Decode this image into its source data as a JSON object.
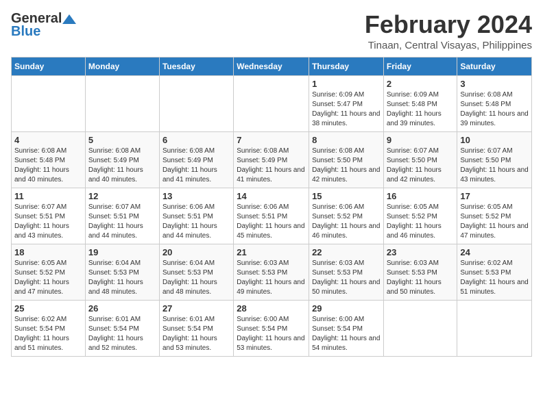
{
  "logo": {
    "general": "General",
    "blue": "Blue"
  },
  "title": "February 2024",
  "subtitle": "Tinaan, Central Visayas, Philippines",
  "days_header": [
    "Sunday",
    "Monday",
    "Tuesday",
    "Wednesday",
    "Thursday",
    "Friday",
    "Saturday"
  ],
  "weeks": [
    [
      {
        "day": "",
        "sunrise": "",
        "sunset": "",
        "daylight": ""
      },
      {
        "day": "",
        "sunrise": "",
        "sunset": "",
        "daylight": ""
      },
      {
        "day": "",
        "sunrise": "",
        "sunset": "",
        "daylight": ""
      },
      {
        "day": "",
        "sunrise": "",
        "sunset": "",
        "daylight": ""
      },
      {
        "day": "1",
        "sunrise": "6:09 AM",
        "sunset": "5:47 PM",
        "daylight": "11 hours and 38 minutes."
      },
      {
        "day": "2",
        "sunrise": "6:09 AM",
        "sunset": "5:48 PM",
        "daylight": "11 hours and 39 minutes."
      },
      {
        "day": "3",
        "sunrise": "6:08 AM",
        "sunset": "5:48 PM",
        "daylight": "11 hours and 39 minutes."
      }
    ],
    [
      {
        "day": "4",
        "sunrise": "6:08 AM",
        "sunset": "5:48 PM",
        "daylight": "11 hours and 40 minutes."
      },
      {
        "day": "5",
        "sunrise": "6:08 AM",
        "sunset": "5:49 PM",
        "daylight": "11 hours and 40 minutes."
      },
      {
        "day": "6",
        "sunrise": "6:08 AM",
        "sunset": "5:49 PM",
        "daylight": "11 hours and 41 minutes."
      },
      {
        "day": "7",
        "sunrise": "6:08 AM",
        "sunset": "5:49 PM",
        "daylight": "11 hours and 41 minutes."
      },
      {
        "day": "8",
        "sunrise": "6:08 AM",
        "sunset": "5:50 PM",
        "daylight": "11 hours and 42 minutes."
      },
      {
        "day": "9",
        "sunrise": "6:07 AM",
        "sunset": "5:50 PM",
        "daylight": "11 hours and 42 minutes."
      },
      {
        "day": "10",
        "sunrise": "6:07 AM",
        "sunset": "5:50 PM",
        "daylight": "11 hours and 43 minutes."
      }
    ],
    [
      {
        "day": "11",
        "sunrise": "6:07 AM",
        "sunset": "5:51 PM",
        "daylight": "11 hours and 43 minutes."
      },
      {
        "day": "12",
        "sunrise": "6:07 AM",
        "sunset": "5:51 PM",
        "daylight": "11 hours and 44 minutes."
      },
      {
        "day": "13",
        "sunrise": "6:06 AM",
        "sunset": "5:51 PM",
        "daylight": "11 hours and 44 minutes."
      },
      {
        "day": "14",
        "sunrise": "6:06 AM",
        "sunset": "5:51 PM",
        "daylight": "11 hours and 45 minutes."
      },
      {
        "day": "15",
        "sunrise": "6:06 AM",
        "sunset": "5:52 PM",
        "daylight": "11 hours and 46 minutes."
      },
      {
        "day": "16",
        "sunrise": "6:05 AM",
        "sunset": "5:52 PM",
        "daylight": "11 hours and 46 minutes."
      },
      {
        "day": "17",
        "sunrise": "6:05 AM",
        "sunset": "5:52 PM",
        "daylight": "11 hours and 47 minutes."
      }
    ],
    [
      {
        "day": "18",
        "sunrise": "6:05 AM",
        "sunset": "5:52 PM",
        "daylight": "11 hours and 47 minutes."
      },
      {
        "day": "19",
        "sunrise": "6:04 AM",
        "sunset": "5:53 PM",
        "daylight": "11 hours and 48 minutes."
      },
      {
        "day": "20",
        "sunrise": "6:04 AM",
        "sunset": "5:53 PM",
        "daylight": "11 hours and 48 minutes."
      },
      {
        "day": "21",
        "sunrise": "6:03 AM",
        "sunset": "5:53 PM",
        "daylight": "11 hours and 49 minutes."
      },
      {
        "day": "22",
        "sunrise": "6:03 AM",
        "sunset": "5:53 PM",
        "daylight": "11 hours and 50 minutes."
      },
      {
        "day": "23",
        "sunrise": "6:03 AM",
        "sunset": "5:53 PM",
        "daylight": "11 hours and 50 minutes."
      },
      {
        "day": "24",
        "sunrise": "6:02 AM",
        "sunset": "5:53 PM",
        "daylight": "11 hours and 51 minutes."
      }
    ],
    [
      {
        "day": "25",
        "sunrise": "6:02 AM",
        "sunset": "5:54 PM",
        "daylight": "11 hours and 51 minutes."
      },
      {
        "day": "26",
        "sunrise": "6:01 AM",
        "sunset": "5:54 PM",
        "daylight": "11 hours and 52 minutes."
      },
      {
        "day": "27",
        "sunrise": "6:01 AM",
        "sunset": "5:54 PM",
        "daylight": "11 hours and 53 minutes."
      },
      {
        "day": "28",
        "sunrise": "6:00 AM",
        "sunset": "5:54 PM",
        "daylight": "11 hours and 53 minutes."
      },
      {
        "day": "29",
        "sunrise": "6:00 AM",
        "sunset": "5:54 PM",
        "daylight": "11 hours and 54 minutes."
      },
      {
        "day": "",
        "sunrise": "",
        "sunset": "",
        "daylight": ""
      },
      {
        "day": "",
        "sunrise": "",
        "sunset": "",
        "daylight": ""
      }
    ]
  ],
  "labels": {
    "sunrise": "Sunrise:",
    "sunset": "Sunset:",
    "daylight": "Daylight:"
  }
}
